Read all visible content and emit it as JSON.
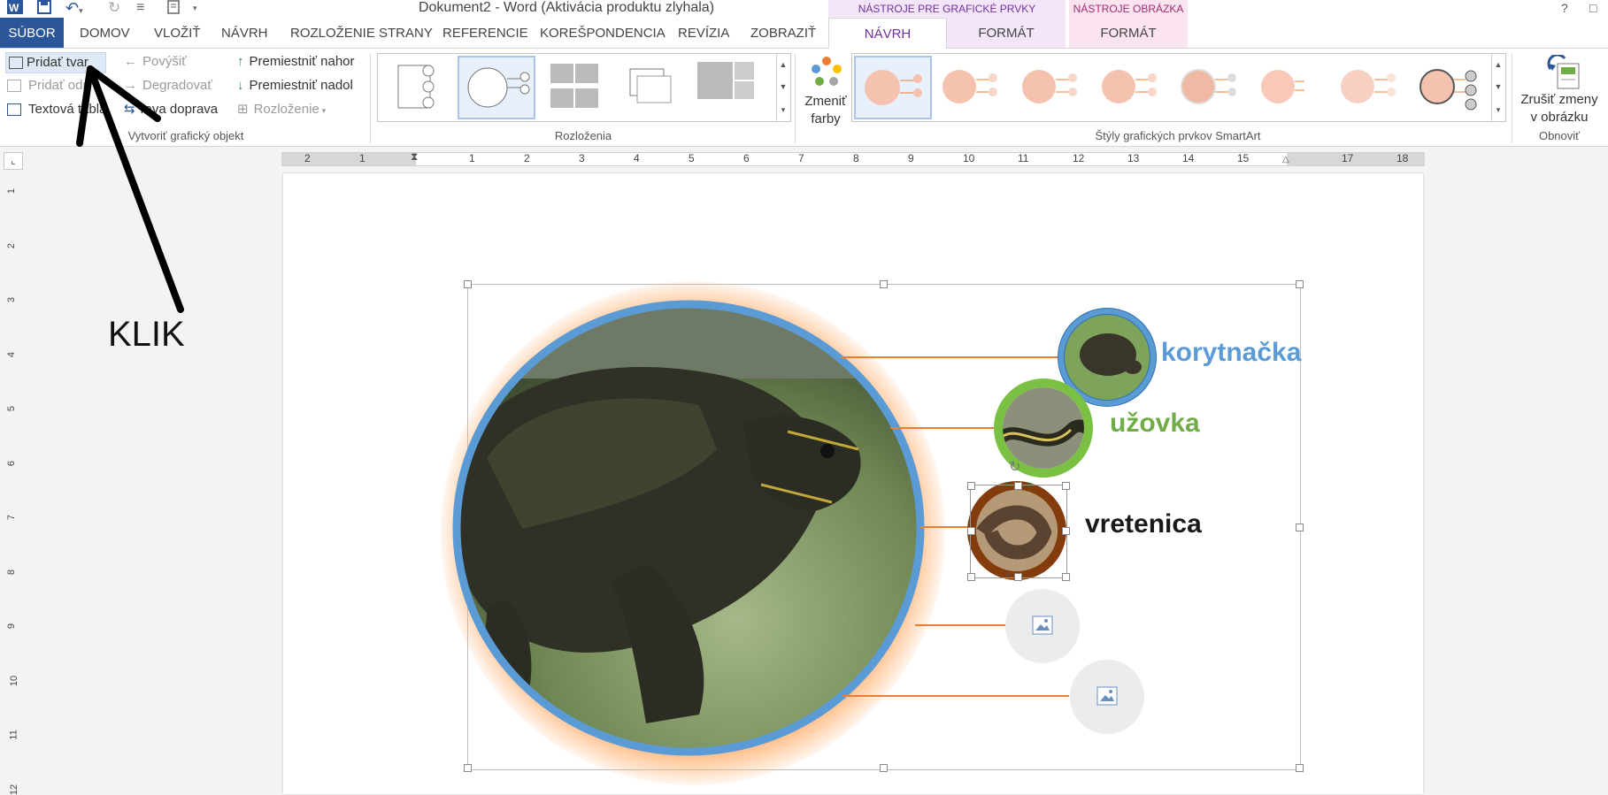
{
  "window": {
    "title": "Dokument2 - Word (Aktivácia produktu zlyhala)",
    "help": "?",
    "restore": "□"
  },
  "tabs": {
    "file": "SÚBOR",
    "home": "DOMOV",
    "insert": "VLOŽIŤ",
    "design": "NÁVRH",
    "layout": "ROZLOŽENIE STRANY",
    "references": "REFERENCIE",
    "mailings": "KOREŠPONDENCIA",
    "review": "REVÍZIA",
    "view": "ZOBRAZIŤ",
    "smartart_design": "NÁVRH",
    "smartart_format": "FORMÁT",
    "picture_format": "FORMÁT"
  },
  "context_groups": {
    "smartart": "NÁSTROJE PRE GRAFICKÉ PRVKY SMARTART",
    "picture": "NÁSTROJE OBRÁZKA"
  },
  "ribbon": {
    "create_graphic": {
      "add_shape": "Pridať tvar",
      "add_bullet": "Pridať odr",
      "text_pane": "Textová tabla",
      "promote": "Povýšiť",
      "demote": "Degradovať",
      "right_to_left": "rava doprava",
      "move_up": "Premiestniť nahor",
      "move_down": "Premiestniť nadol",
      "layout": "Rozloženie",
      "group_label": "Vytvoriť grafický objekt"
    },
    "layouts": {
      "group_label": "Rozloženia"
    },
    "styles": {
      "change_colors_line1": "Zmeniť",
      "change_colors_line2": "farby",
      "group_label": "Štýly grafických prvkov SmartArt"
    },
    "reset": {
      "reset_line1": "Zrušiť zmeny",
      "reset_line2": "v obrázku",
      "group_label": "Obnoviť"
    }
  },
  "ruler": {
    "h_labels": [
      "2",
      "1",
      "1",
      "2",
      "3",
      "4",
      "5",
      "6",
      "7",
      "8",
      "9",
      "10",
      "11",
      "12",
      "13",
      "14",
      "15",
      "17",
      "18"
    ],
    "v_labels": [
      "1",
      "2",
      "3",
      "4",
      "5",
      "6",
      "7",
      "8",
      "9",
      "10",
      "11",
      "12"
    ]
  },
  "annotation": {
    "text": "KLIK"
  },
  "smartart": {
    "items": [
      {
        "label": "korytnačka",
        "color": "#5b9bd5"
      },
      {
        "label": "užovka",
        "color": "#70ad47"
      },
      {
        "label": "vretenica",
        "color": "#1a1a1a"
      }
    ],
    "line_color": "#ed7d31",
    "accent_blue": "#5b9bd5",
    "accent_green": "#7ac143",
    "accent_brown": "#843c0c"
  },
  "colors": {
    "file_tab": "#2b579a",
    "context_tab_text": "#7030a0",
    "smartart_band": "#f3e6f8",
    "picture_band": "#fbe4f0"
  }
}
